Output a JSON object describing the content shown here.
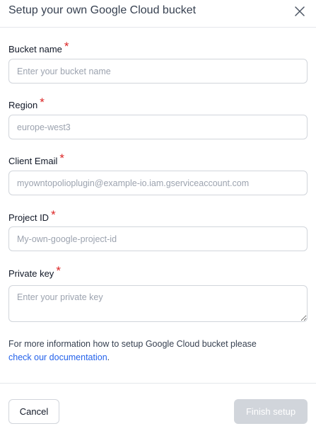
{
  "dialog": {
    "title": "Setup your own Google Cloud bucket",
    "close_icon": "close-icon"
  },
  "fields": {
    "bucket_name": {
      "label": "Bucket name",
      "required_mark": "*",
      "placeholder": "Enter your bucket name"
    },
    "region": {
      "label": "Region",
      "required_mark": "*",
      "placeholder": "europe-west3"
    },
    "client_email": {
      "label": "Client Email",
      "required_mark": "*",
      "placeholder": "myowntopolioplugin@example-io.iam.gserviceaccount.com"
    },
    "project_id": {
      "label": "Project ID",
      "required_mark": "*",
      "placeholder": "My-own-google-project-id"
    },
    "private_key": {
      "label": "Private key",
      "required_mark": "*",
      "placeholder": "Enter your private key"
    }
  },
  "info": {
    "text": "For more information how to setup Google Cloud bucket please",
    "link_text": "check our documentation",
    "trailing": "."
  },
  "footer": {
    "cancel_label": "Cancel",
    "finish_label": "Finish setup"
  },
  "colors": {
    "required": "#dc2626",
    "link": "#2563eb",
    "disabled_button": "#d1d5db"
  }
}
